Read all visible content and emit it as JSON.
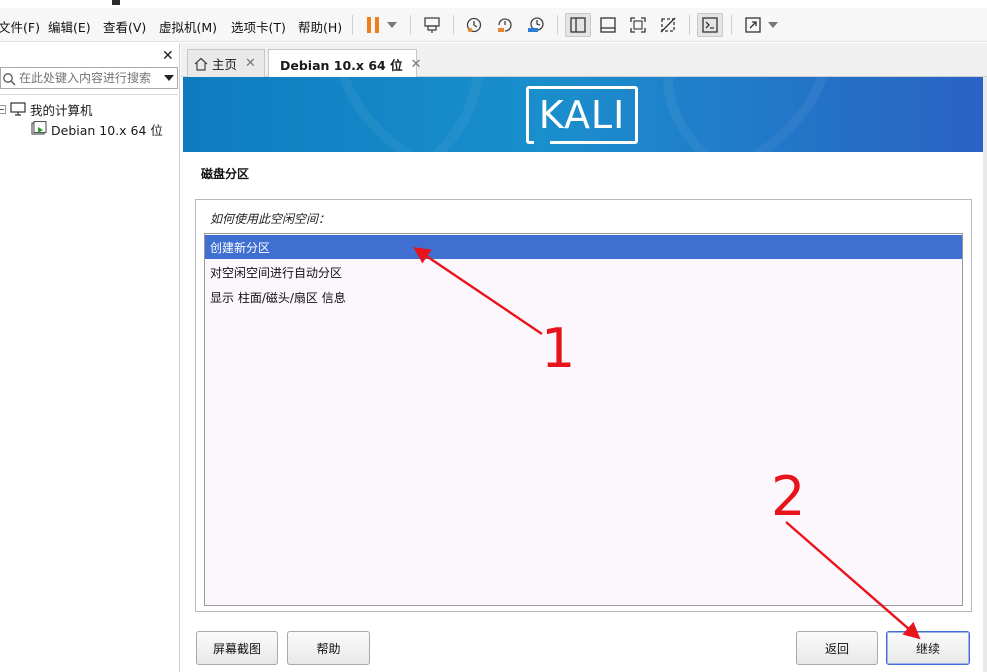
{
  "menu": {
    "items": [
      {
        "label": "文件(F)"
      },
      {
        "label": "编辑(E)"
      },
      {
        "label": "查看(V)"
      },
      {
        "label": "虚拟机(M)"
      },
      {
        "label": "选项卡(T)"
      },
      {
        "label": "帮助(H)"
      }
    ]
  },
  "toolbar": {
    "icons": [
      "pause-icon",
      "dropdown-arrow-icon",
      "send-keys-icon",
      "snapshot-icon",
      "revert-snapshot-icon",
      "snapshot-manager-icon",
      "library-view-icon",
      "console-view-icon",
      "fullscreen-icon",
      "unity-icon",
      "terminal-icon",
      "stretch-icon",
      "dropdown-arrow-icon"
    ],
    "pause_color": "#f07d18"
  },
  "sidebar": {
    "search_placeholder": "在此处键入内容进行搜索",
    "tree": {
      "root_label": "我的计算机",
      "child_label": "Debian 10.x 64 位"
    }
  },
  "tabs": [
    {
      "label": "主页",
      "icon": "home-icon",
      "active": false
    },
    {
      "label": "Debian 10.x 64 位",
      "icon": "vm-icon",
      "active": true
    }
  ],
  "installer": {
    "brand": "KALI",
    "banner_color": "#1a8fcd",
    "title": "磁盘分区",
    "question": "如何使用此空闲空间：",
    "options": [
      {
        "label": "创建新分区",
        "selected": true
      },
      {
        "label": "对空闲空间进行自动分区",
        "selected": false
      },
      {
        "label": "显示 柱面/磁头/扇区 信息",
        "selected": false
      }
    ],
    "buttons": {
      "screenshot": "屏幕截图",
      "help": "帮助",
      "back": "返回",
      "continue": "继续"
    }
  },
  "annotations": {
    "color": "#e8141b",
    "step1": "1",
    "step2": "2"
  }
}
